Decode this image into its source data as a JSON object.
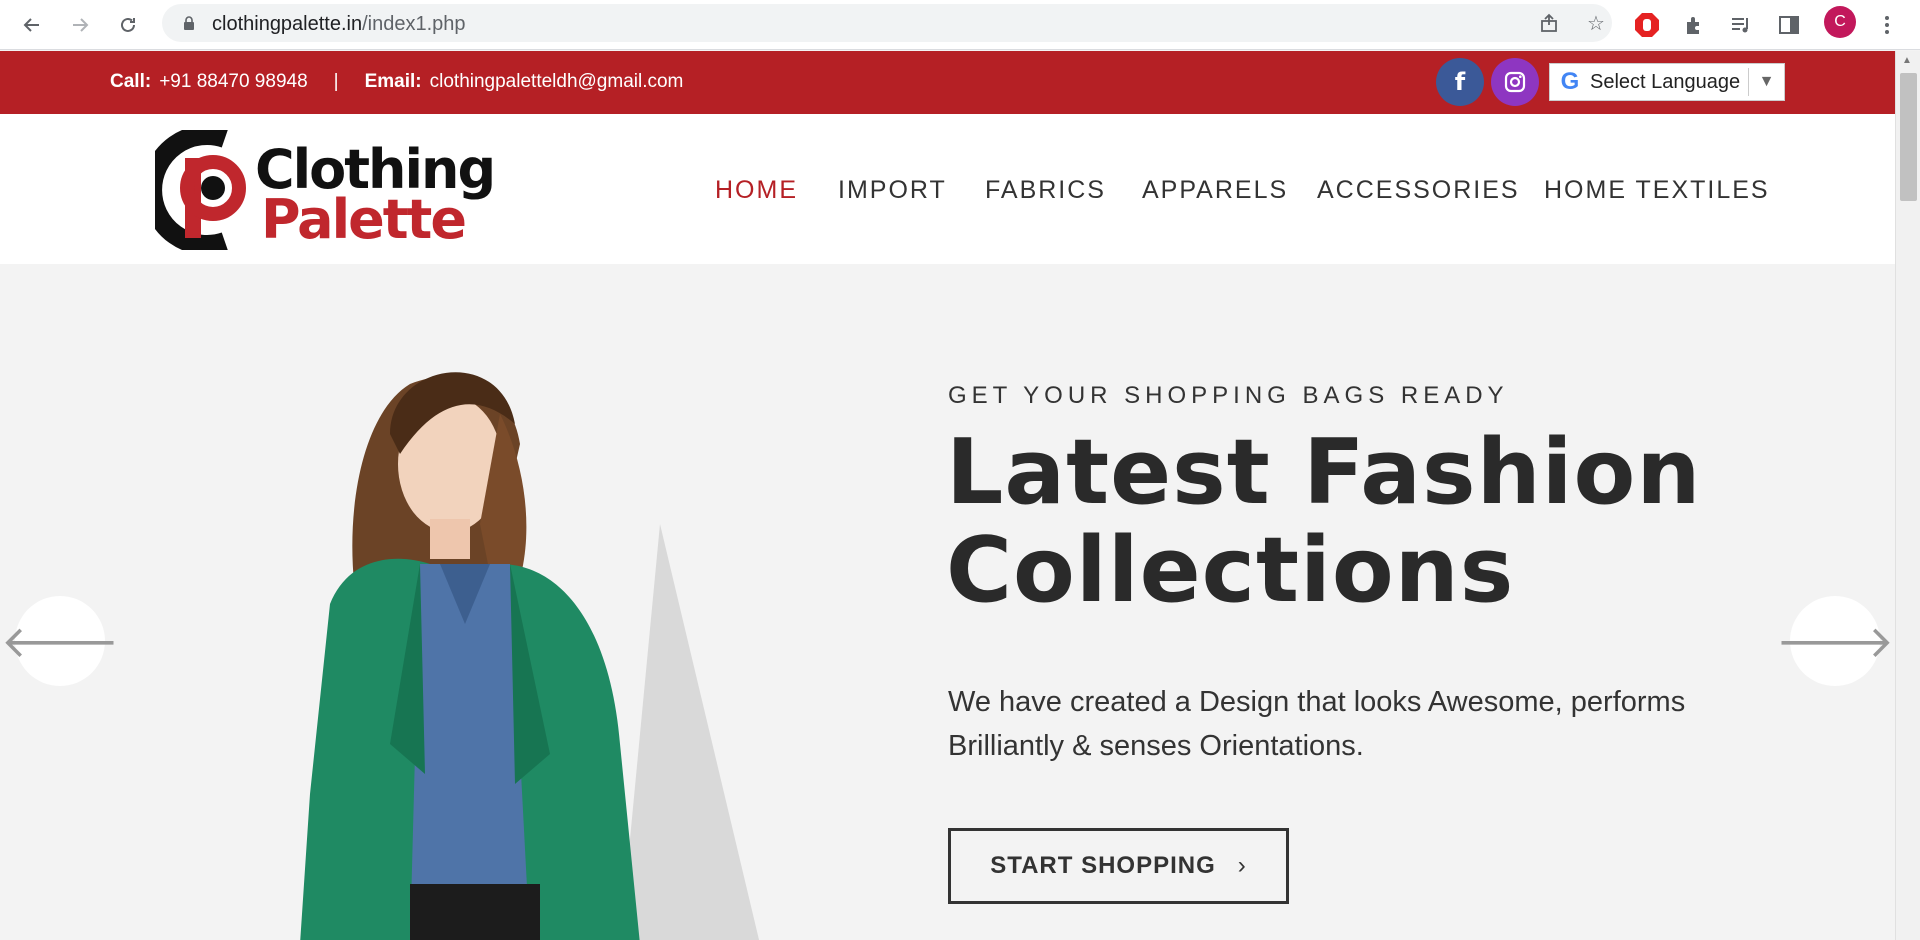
{
  "browser": {
    "url_domain": "clothingpalette.in",
    "url_path": "/index1.php",
    "avatar_letter": "C",
    "icons": [
      "back-icon",
      "forward-icon",
      "reload-icon",
      "lock-icon",
      "share-icon",
      "star-icon",
      "adblock-icon",
      "extensions-icon",
      "media-icon",
      "sidepanel-icon",
      "menu-icon"
    ]
  },
  "topbar": {
    "call_label": "Call:",
    "call_value": "+91 88470 98948",
    "separator": "|",
    "email_label": "Email:",
    "email_value": "clothingpaletteldh@gmail.com",
    "facebook_glyph": "f",
    "language_label": "Select Language",
    "google_glyph": "G",
    "bg_color": "#b52025"
  },
  "header": {
    "logo_line1": "Clothing",
    "logo_line2": "Palette",
    "menu": [
      {
        "label": "HOME",
        "active": true
      },
      {
        "label": "IMPORT",
        "active": false
      },
      {
        "label": "FABRICS",
        "active": false
      },
      {
        "label": "APPARELS",
        "active": false
      },
      {
        "label": "ACCESSORIES",
        "active": false
      },
      {
        "label": "HOME TEXTILES",
        "active": false
      }
    ]
  },
  "hero": {
    "kicker": "GET YOUR SHOPPING BAGS READY",
    "title_line1": "Latest Fashion",
    "title_line2": "Collections",
    "description": "We have created a Design that looks Awesome, performs Brilliantly & senses Orientations.",
    "cta_label": "START SHOPPING",
    "cta_chevron": "›",
    "prev_glyph": "🡐",
    "next_glyph": "🡒"
  }
}
